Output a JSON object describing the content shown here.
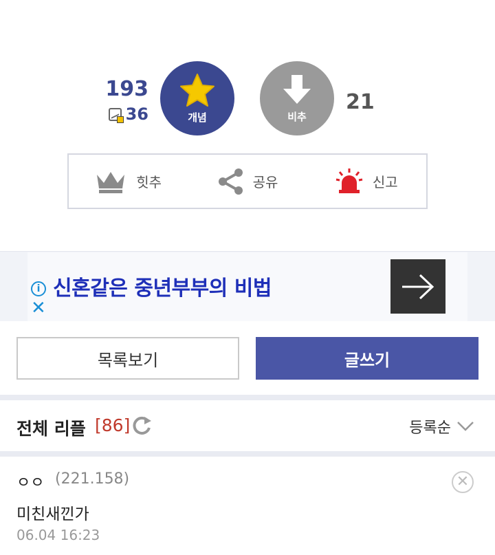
{
  "vote": {
    "up_count": "193",
    "fixed_count": "36",
    "up_label": "개념",
    "down_label": "비추",
    "down_count": "21",
    "colors": {
      "up": "#3b4890",
      "down": "#9a9a9a",
      "star": "#f5c800"
    }
  },
  "actions": [
    {
      "label": "힛추",
      "icon": "crown-icon"
    },
    {
      "label": "공유",
      "icon": "share-icon"
    },
    {
      "label": "신고",
      "icon": "siren-icon"
    }
  ],
  "ad": {
    "info_glyph": "i",
    "close_glyph": "✕",
    "title": "신혼같은 중년부부의 비법",
    "arrow_icon": "arrow-right-icon"
  },
  "buttons": {
    "list_label": "목록보기",
    "write_label": "글쓰기"
  },
  "replies": {
    "title": "전체 리플",
    "count": "[86]",
    "sort_label": "등록순",
    "items": [
      {
        "nick": "ㅇㅇ",
        "ip": "(221.158)",
        "text": "미친새낀가",
        "date": "06.04 16:23",
        "delete_glyph": "✕"
      }
    ]
  }
}
